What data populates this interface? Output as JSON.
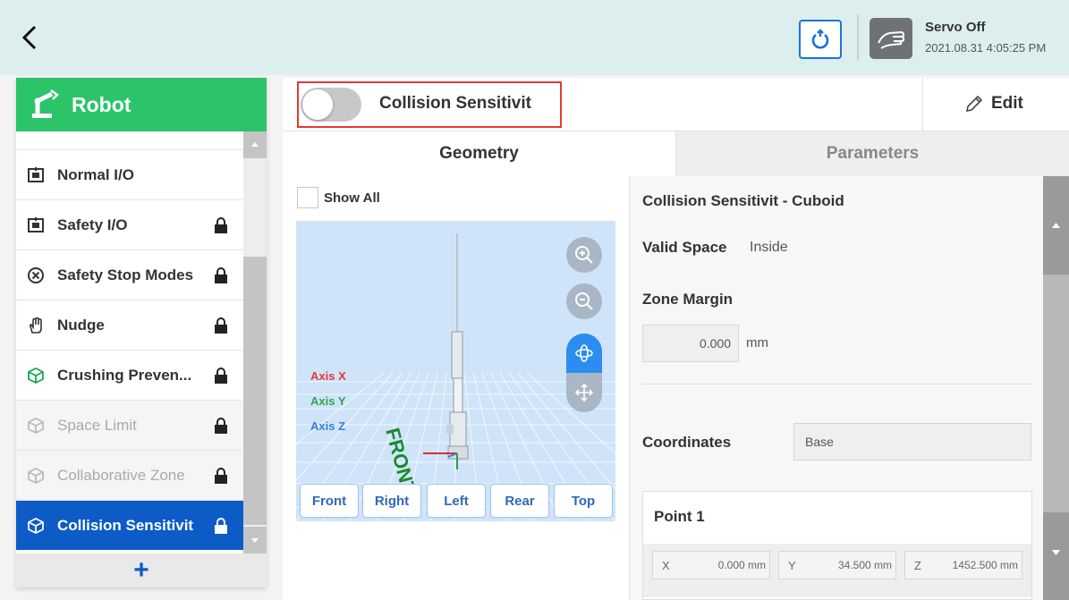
{
  "header": {
    "servo_status": "Servo Off",
    "datetime": "2021.08.31 4:05:25 PM"
  },
  "sidebar": {
    "title": "Robot",
    "items": [
      {
        "label": "Normal I/O",
        "icon": "io-port-icon",
        "locked": false,
        "state": "normal"
      },
      {
        "label": "Safety I/O",
        "icon": "io-port-icon",
        "locked": true,
        "state": "normal"
      },
      {
        "label": "Safety Stop Modes",
        "icon": "stop-circle-icon",
        "locked": true,
        "state": "normal"
      },
      {
        "label": "Nudge",
        "icon": "hand-icon",
        "locked": true,
        "state": "normal"
      },
      {
        "label": "Crushing Preven...",
        "icon": "cube-icon",
        "locked": true,
        "state": "normal"
      },
      {
        "label": "Space Limit",
        "icon": "cube-icon",
        "locked": true,
        "state": "disabled"
      },
      {
        "label": "Collaborative Zone",
        "icon": "cube-icon",
        "locked": true,
        "state": "disabled"
      },
      {
        "label": "Collision Sensitivit",
        "icon": "cube-icon",
        "locked": true,
        "state": "active"
      }
    ],
    "add_label": "+"
  },
  "zone": {
    "title": "Collision Sensitivit",
    "enabled": false,
    "edit_label": "Edit"
  },
  "tabs": {
    "geometry": "Geometry",
    "parameters": "Parameters",
    "active": "geometry"
  },
  "viewer": {
    "show_all_label": "Show All",
    "axis_x": "Axis X",
    "axis_y": "Axis Y",
    "axis_z": "Axis Z",
    "floor_label": "FRONT",
    "view_buttons": [
      "Front",
      "Right",
      "Left",
      "Rear",
      "Top"
    ]
  },
  "details": {
    "title": "Collision Sensitivit - Cuboid",
    "valid_space_label": "Valid Space",
    "valid_space_value": "Inside",
    "zone_margin_label": "Zone Margin",
    "zone_margin_value": "0.000",
    "zone_margin_unit": "mm",
    "coordinates_label": "Coordinates",
    "coordinates_value": "Base",
    "point1": {
      "title": "Point 1",
      "x_label": "X",
      "x": "0.000 mm",
      "y_label": "Y",
      "y": "34.500 mm",
      "z_label": "Z",
      "z": "1452.500 mm"
    }
  },
  "colors": {
    "accent_green": "#2bc468",
    "active_blue": "#0d5bc6",
    "highlight_red": "#e53935",
    "axis_x": "#e53935",
    "axis_y": "#2ea84a",
    "axis_z": "#3b7ddd"
  }
}
